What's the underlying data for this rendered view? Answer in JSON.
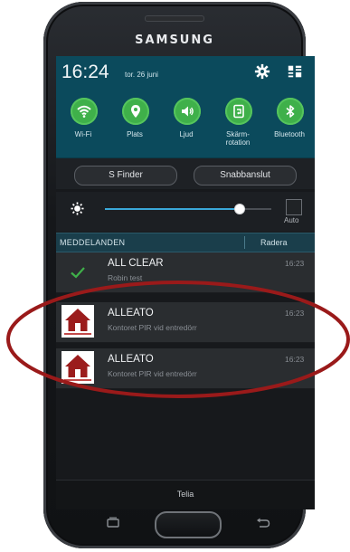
{
  "device": {
    "brand": "SAMSUNG"
  },
  "status_bar": {
    "time": "16:24",
    "date": "tor. 26 juni",
    "icons": [
      "gear-icon",
      "grid-icon"
    ]
  },
  "quick_toggles": [
    {
      "label": "Wi-Fi",
      "icon": "wifi-icon",
      "active": true
    },
    {
      "label": "Plats",
      "icon": "location-icon",
      "active": true
    },
    {
      "label": "Ljud",
      "icon": "sound-icon",
      "active": true
    },
    {
      "label": "Skärm-\nrotation",
      "icon": "rotation-icon",
      "active": true
    },
    {
      "label": "Bluetooth",
      "icon": "bluetooth-icon",
      "active": true
    }
  ],
  "buttons": {
    "s_finder": "S Finder",
    "quick_connect": "Snabbanslut"
  },
  "brightness": {
    "level": 0.81,
    "auto_label": "Auto",
    "auto_checked": false
  },
  "notifications_header": {
    "title": "MEDDELANDEN",
    "clear_label": "Radera"
  },
  "notifications": [
    {
      "title": "ALL CLEAR",
      "subtitle": "Robin test",
      "time": "16:23",
      "icon": "check-icon"
    },
    {
      "title": "ALLEATO",
      "subtitle": "Kontoret PIR vid entredörr",
      "time": "16:23",
      "icon": "house-icon"
    },
    {
      "title": "ALLEATO",
      "subtitle": "Kontoret PIR vid entredörr",
      "time": "16:23",
      "icon": "house-icon"
    }
  ],
  "carrier": "Telia",
  "colors": {
    "panel_teal": "#0b4a5c",
    "toggle_green": "#3fb04a",
    "slider_blue": "#3aa8d8",
    "annotation_red": "#9a1a1a",
    "house_red": "#9b1c1c"
  }
}
